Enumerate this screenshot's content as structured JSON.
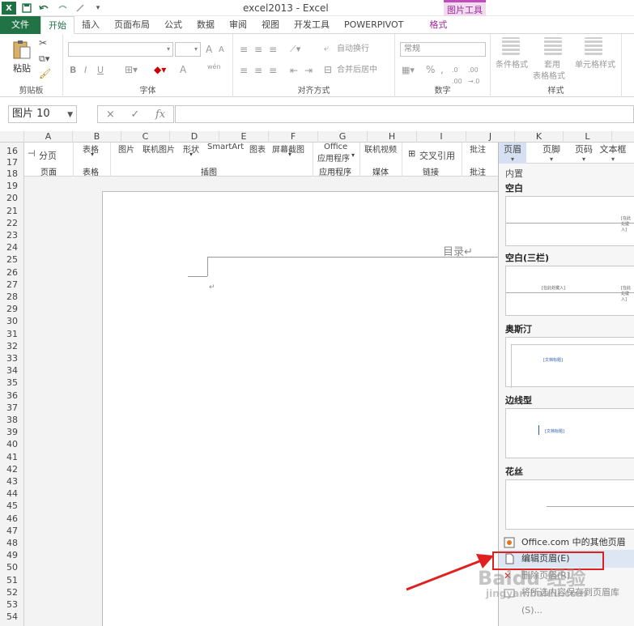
{
  "titlebar": {
    "title": "excel2013 - Excel",
    "context_tab_group": "图片工具",
    "qat": [
      "save-icon",
      "undo-icon",
      "redo-icon",
      "touch-mode-icon",
      "customize-icon"
    ]
  },
  "tabs": [
    {
      "label": "文件",
      "kind": "file"
    },
    {
      "label": "开始",
      "kind": "active"
    },
    {
      "label": "插入",
      "kind": ""
    },
    {
      "label": "页面布局",
      "kind": ""
    },
    {
      "label": "公式",
      "kind": ""
    },
    {
      "label": "数据",
      "kind": ""
    },
    {
      "label": "审阅",
      "kind": ""
    },
    {
      "label": "视图",
      "kind": ""
    },
    {
      "label": "开发工具",
      "kind": ""
    },
    {
      "label": "POWERPIVOT",
      "kind": ""
    },
    {
      "label": "格式",
      "kind": "ctx"
    }
  ],
  "ribbon": {
    "clipboard": {
      "paste": "粘贴",
      "label": "剪贴板"
    },
    "font": {
      "label": "字体",
      "bold": "B",
      "italic": "I",
      "underline": "U",
      "grow": "A",
      "shrink": "A",
      "color_a": "A",
      "wen": "wén"
    },
    "alignment": {
      "label": "对齐方式",
      "wrap": "自动换行",
      "merge": "合并后居中"
    },
    "number": {
      "label": "数字",
      "format": "常规",
      "percent": "%",
      "comma": ","
    },
    "styles": {
      "label": "样式",
      "conditional": "条件格式",
      "table_line1": "套用",
      "table_line2": "表格格式",
      "cell": "单元格样式"
    },
    "accent": "#217346"
  },
  "formulabar": {
    "namebox": "图片 10",
    "cancel": "×",
    "enter": "✓",
    "fx": "fx"
  },
  "columns": [
    "A",
    "B",
    "C",
    "D",
    "E",
    "F",
    "G",
    "H",
    "I",
    "J",
    "K",
    "L"
  ],
  "rows": [
    "16",
    "17",
    "18",
    "19",
    "20",
    "21",
    "22",
    "23",
    "24",
    "25",
    "26",
    "27",
    "28",
    "29",
    "30",
    "31",
    "32",
    "33",
    "34",
    "35",
    "36",
    "37",
    "38",
    "39",
    "40",
    "41",
    "42",
    "43",
    "44",
    "45",
    "46",
    "47",
    "48",
    "49",
    "50",
    "51",
    "52",
    "53",
    "54"
  ],
  "word_ribbon": {
    "page_break": "分页",
    "table": "表格",
    "picture": "图片",
    "online_picture": "联机图片",
    "shapes": "形状",
    "smartart": "SmartArt",
    "chart": "图表",
    "screenshot": "屏幕截图",
    "office_line1": "Office",
    "office_line2": "应用程序",
    "online_video": "联机视频",
    "cross_ref": "交叉引用",
    "comment": "批注",
    "header": "页眉",
    "footer": "页脚",
    "page_number": "页码",
    "textbox": "文本框",
    "groups": {
      "pages": "页面",
      "tables": "表格",
      "illustrations": "插图",
      "apps": "应用程序",
      "media": "媒体",
      "links": "链接",
      "comments": "批注"
    }
  },
  "document": {
    "toc_text": "目录↵",
    "para_mark": "↵"
  },
  "gallery": {
    "builtin": "内置",
    "sections": [
      {
        "label": "空白",
        "thumb_text": "[在此处键入]"
      },
      {
        "label": "空白(三栏)",
        "thumb_text_left": "[在此处键入]",
        "thumb_text_right": "[在此处键入]"
      },
      {
        "label": "奥斯汀",
        "thumb_text": "[文档标题]"
      },
      {
        "label": "边线型",
        "thumb_text": "[文档标题]"
      },
      {
        "label": "花丝",
        "thumb_text": ""
      }
    ],
    "menu": [
      {
        "label": "Office.com 中的其他页眉(M)",
        "icon": "office-icon"
      },
      {
        "label": "编辑页眉(E)",
        "icon": "page-icon"
      },
      {
        "label": "删除页眉(R)",
        "icon": "delete-icon"
      },
      {
        "label": "将所选内容保存到页眉库(S)...",
        "icon": "save-selection-icon"
      }
    ]
  },
  "annotation": {
    "highlight_color": "#e02020"
  }
}
